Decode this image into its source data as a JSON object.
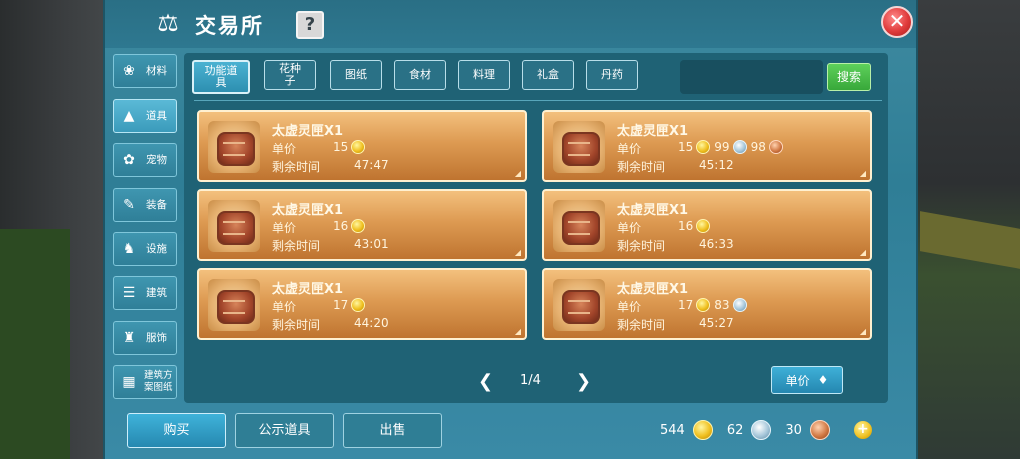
{
  "window": {
    "title": "交易所",
    "help_label": "?",
    "close_label": "✕"
  },
  "sidebar": {
    "items": [
      {
        "label": "材料",
        "icon": "cotton-icon"
      },
      {
        "label": "道具",
        "icon": "flask-icon"
      },
      {
        "label": "宠物",
        "icon": "paw-icon"
      },
      {
        "label": "装备",
        "icon": "sword-icon"
      },
      {
        "label": "设施",
        "icon": "horse-icon"
      },
      {
        "label": "建筑",
        "icon": "building-icon"
      },
      {
        "label": "服饰",
        "icon": "clothes-icon"
      },
      {
        "label": "建筑方案图纸",
        "icon": "blueprint-icon"
      }
    ],
    "active_index": 1
  },
  "tabs": [
    {
      "label": "功能道具"
    },
    {
      "label": "花种子"
    },
    {
      "label": "图纸"
    },
    {
      "label": "食材"
    },
    {
      "label": "料理"
    },
    {
      "label": "礼盒"
    },
    {
      "label": "丹药"
    }
  ],
  "search": {
    "value": "",
    "button_label": "搜索"
  },
  "labels": {
    "price": "单价",
    "time_left": "剩余时间"
  },
  "listings": [
    {
      "name": "太虚灵匣X1",
      "prices": [
        {
          "amount": "15",
          "coin": "gold"
        }
      ],
      "time_left": "47:47"
    },
    {
      "name": "太虚灵匣X1",
      "prices": [
        {
          "amount": "15",
          "coin": "gold"
        },
        {
          "amount": "99",
          "coin": "silver"
        },
        {
          "amount": "98",
          "coin": "copper"
        }
      ],
      "time_left": "45:12"
    },
    {
      "name": "太虚灵匣X1",
      "prices": [
        {
          "amount": "16",
          "coin": "gold"
        }
      ],
      "time_left": "43:01"
    },
    {
      "name": "太虚灵匣X1",
      "prices": [
        {
          "amount": "16",
          "coin": "gold"
        }
      ],
      "time_left": "46:33"
    },
    {
      "name": "太虚灵匣X1",
      "prices": [
        {
          "amount": "17",
          "coin": "gold"
        }
      ],
      "time_left": "44:20"
    },
    {
      "name": "太虚灵匣X1",
      "prices": [
        {
          "amount": "17",
          "coin": "gold"
        },
        {
          "amount": "83",
          "coin": "silver"
        }
      ],
      "time_left": "45:27"
    }
  ],
  "pagination": {
    "label": "1/4",
    "prev": "❮",
    "next": "❯"
  },
  "sort": {
    "label": "单价",
    "icon": "sort-arrow-icon"
  },
  "actions": {
    "buy": "购买",
    "public_items": "公示道具",
    "sell": "出售"
  },
  "wallet": {
    "gold": "544",
    "silver": "62",
    "copper": "30",
    "add_label": "+"
  },
  "colors": {
    "accent": "#2f7e96",
    "card": "#dd9a52",
    "search_button": "#38a83a",
    "close": "#e03b3b"
  }
}
